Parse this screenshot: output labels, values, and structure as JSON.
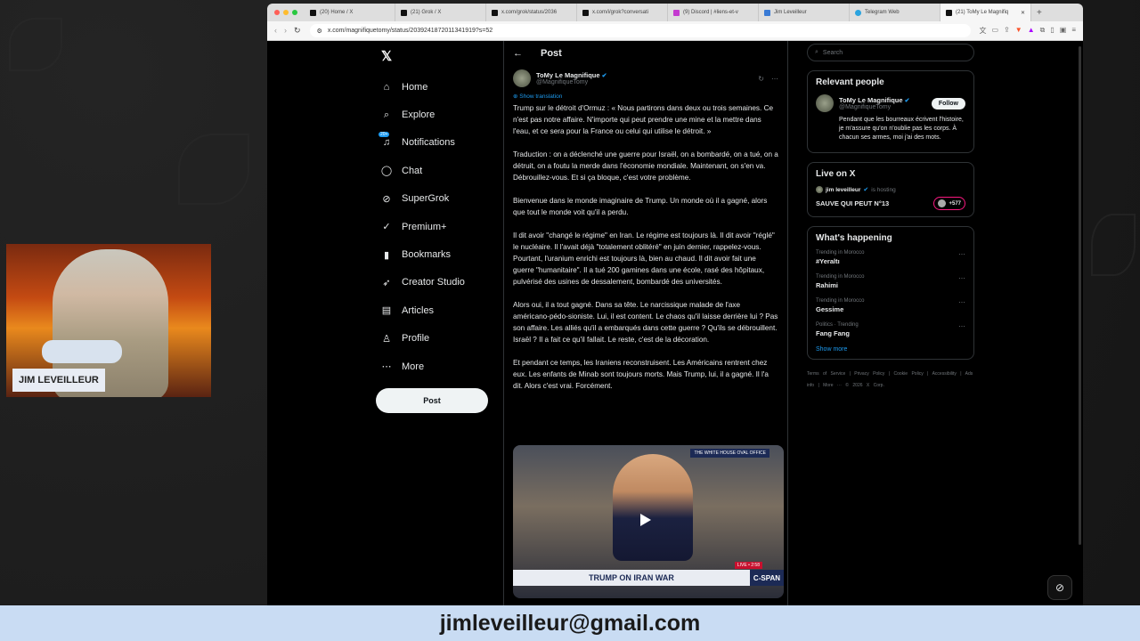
{
  "browser": {
    "tabs": [
      {
        "label": "(20) Home / X",
        "active": false
      },
      {
        "label": "(21) Grok / X",
        "active": false
      },
      {
        "label": "x.com/grok/status/2036",
        "active": false
      },
      {
        "label": "x.com/i/grok?conversati",
        "active": false
      },
      {
        "label": "(9) Discord | #liens-et-v",
        "active": false
      },
      {
        "label": "Jim Leveilleur",
        "active": false
      },
      {
        "label": "Telegram Web",
        "active": false
      },
      {
        "label": "(21) ToMy Le Magnifiq",
        "active": true
      }
    ],
    "url": "x.com/magnifiquetomy/status/2039241872011341919?s=52"
  },
  "nav": {
    "items": [
      {
        "label": "Home",
        "icon": "home-icon",
        "glyph": "⌂"
      },
      {
        "label": "Explore",
        "icon": "search-icon",
        "glyph": "⌕"
      },
      {
        "label": "Notifications",
        "icon": "bell-icon",
        "glyph": "♫",
        "badge": "20+"
      },
      {
        "label": "Chat",
        "icon": "chat-icon",
        "glyph": "◯"
      },
      {
        "label": "SuperGrok",
        "icon": "grok-icon",
        "glyph": "⊘"
      },
      {
        "label": "Premium+",
        "icon": "premium-icon",
        "glyph": "✓"
      },
      {
        "label": "Bookmarks",
        "icon": "bookmark-icon",
        "glyph": "▮"
      },
      {
        "label": "Creator Studio",
        "icon": "rocket-icon",
        "glyph": "➶"
      },
      {
        "label": "Articles",
        "icon": "article-icon",
        "glyph": "▤"
      },
      {
        "label": "Profile",
        "icon": "profile-icon",
        "glyph": "♙"
      },
      {
        "label": "More",
        "icon": "more-icon",
        "glyph": "⋯"
      }
    ],
    "post_button": "Post"
  },
  "post": {
    "header": "Post",
    "author_name": "ToMy Le Magnifique",
    "author_handle": "@MagnifiqueTomy",
    "show_translation": "Show translation",
    "paragraphs": [
      "Trump sur le détroit d'Ormuz : « Nous partirons dans deux ou trois semaines. Ce n'est pas notre affaire. N'importe qui peut prendre une mine et la mettre dans l'eau, et ce sera pour la France ou celui qui utilise le détroit. »",
      "Traduction : on a déclenché une guerre pour Israël, on a bombardé, on a tué, on a détruit, on a foutu la merde dans l'économie mondiale. Maintenant, on s'en va. Débrouillez-vous. Et si ça bloque, c'est votre problème.",
      "Bienvenue dans le monde imaginaire de Trump. Un monde où il a gagné, alors que tout le monde voit qu'il a perdu.",
      "Il dit avoir \"changé le régime\" en Iran. Le régime est toujours là. Il dit avoir \"réglé\" le nucléaire. Il l'avait déjà \"totalement oblitéré\" en juin dernier, rappelez-vous. Pourtant, l'uranium enrichi est toujours là, bien au chaud. Il dit avoir fait une guerre \"humanitaire\". Il a tué 200 gamines dans une école, rasé des hôpitaux, pulvérisé des usines de dessalement, bombardé des universités.",
      "Alors oui, il a tout gagné. Dans sa tête. Le narcissique malade de l'axe américano-pédo-sioniste. Lui, il est content. Le chaos qu'il laisse derrière lui ? Pas son affaire. Les alliés qu'il a embarqués dans cette guerre ? Qu'ils se débrouillent. Israël ? Il a fait ce qu'il fallait. Le reste, c'est de la décoration.",
      "Et pendant ce temps, les Iraniens reconstruisent. Les Américains rentrent chez eux. Les enfants de Minab sont toujours morts. Mais Trump, lui, il a gagné. Il l'a dit. Alors c'est vrai. Forcément."
    ],
    "video": {
      "chyron": "TRUMP ON IRAN WAR",
      "network": "C-SPAN",
      "corner_tag": "THE WHITE HOUSE OVAL OFFICE",
      "live_tag": "LIVE • 2:58"
    }
  },
  "sidebar": {
    "search_placeholder": "Search",
    "relevant_title": "Relevant people",
    "relevant_person": {
      "name": "ToMy Le Magnifique",
      "handle": "@MagnifiqueTomy",
      "follow": "Follow",
      "bio": "Pendant que les bourreaux écrivent l'histoire, je m'assure qu'on n'oublie pas les corps. À chacun ses armes, moi j'ai des mots."
    },
    "live_title": "Live on X",
    "live": {
      "host": "jim leveilleur",
      "status": "is hosting",
      "space_title": "SAUVE QUI PEUT N°13",
      "listeners": "+577"
    },
    "happening_title": "What's happening",
    "trends": [
      {
        "meta": "Trending in Morocco",
        "name": "#Yeraltı"
      },
      {
        "meta": "Trending in Morocco",
        "name": "Rahimi"
      },
      {
        "meta": "Trending in Morocco",
        "name": "Gessime"
      },
      {
        "meta": "Politics · Trending",
        "name": "Fang Fang"
      }
    ],
    "show_more": "Show more",
    "footer": "Terms of Service | Privacy Policy | Cookie Policy | Accessibility | Ads info | More ··· © 2026 X Corp."
  },
  "webcam": {
    "nameplate": "JIM LEVEILLEUR"
  },
  "bottom_banner": {
    "email": "jimleveilleur@gmail.com"
  }
}
